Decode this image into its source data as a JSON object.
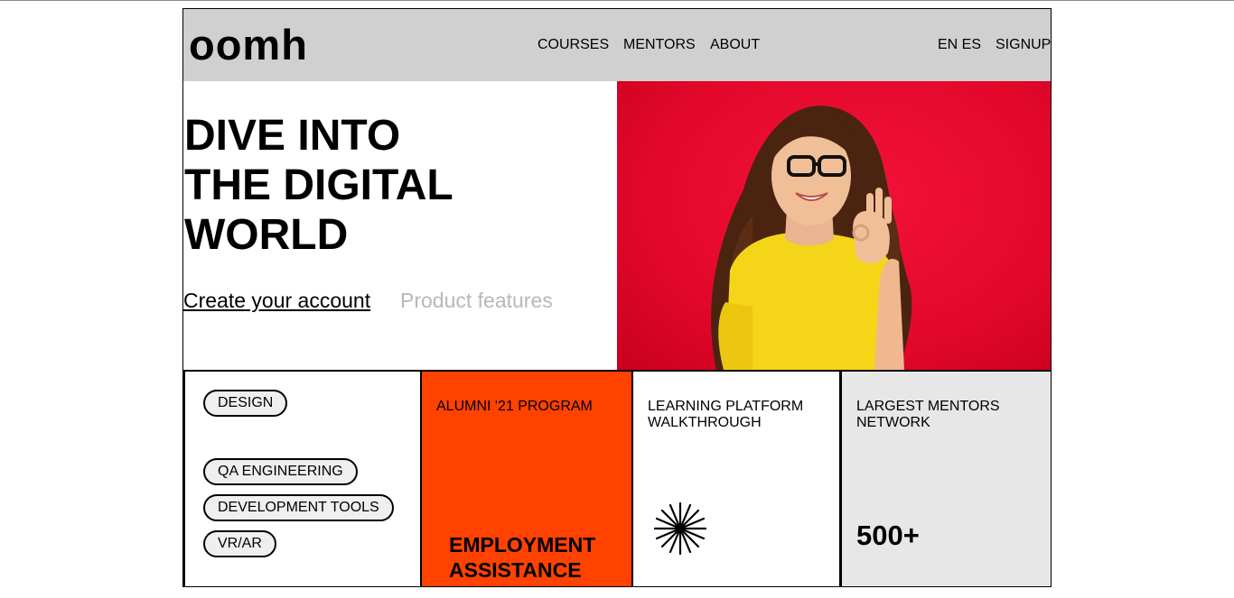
{
  "header": {
    "logo": "oomh",
    "nav": [
      {
        "label": "COURSES"
      },
      {
        "label": "MENTORS"
      },
      {
        "label": "ABOUT"
      }
    ],
    "lang": "EN ES",
    "signup": "SIGNUP"
  },
  "hero": {
    "headline": [
      "DIVE INTO",
      "THE DIGITAL",
      "WORLD"
    ],
    "cta_primary": "Create your account",
    "cta_secondary": "Product features"
  },
  "cards": {
    "tags": [
      "DESIGN",
      "QA ENGINEERING",
      "DEVELOPMENT TOOLS",
      "VR/AR"
    ],
    "alumni": {
      "title": "ALUMNI '21 PROGRAM",
      "heading": "EMPLOYMENT\nASSISTANCE"
    },
    "walkthrough": {
      "title": "LEARNING PLATFORM\nWALKTHROUGH"
    },
    "mentors": {
      "title": "LARGEST MENTORS\nNETWORK",
      "count": "500+"
    }
  },
  "colors": {
    "header_bg": "#d0d0d0",
    "hero_red": "#e3082b",
    "alumni_orange": "#ff4200",
    "card_gray": "#e7e7e7",
    "muted_link": "#b8b8b8"
  },
  "icons": {
    "burst": "starburst-icon"
  }
}
